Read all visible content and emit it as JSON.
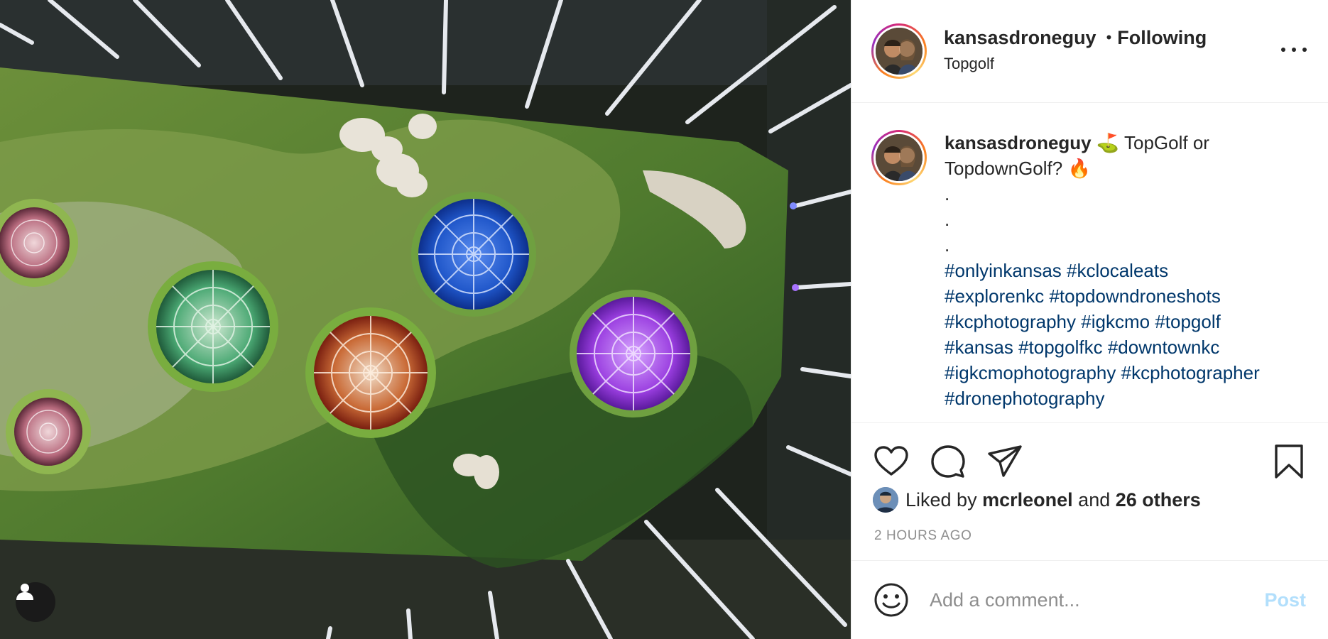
{
  "post": {
    "author": {
      "username": "kansasdroneguy",
      "follow_status": "Following",
      "location": "Topgolf"
    },
    "caption": {
      "username": "kansasdroneguy",
      "text": "⛳ TopGolf or TopdownGolf? 🔥",
      "dot_lines": [
        ".",
        ".",
        "."
      ],
      "hashtags": [
        "#onlyinkansas",
        "#kclocaleats",
        "#explorenkc",
        "#topdowndroneshots",
        "#kcphotography",
        "#igkcmo",
        "#topgolf",
        "#kansas",
        "#topgolfkc",
        "#downtownkc",
        "#igkcmophotography",
        "#kcphotographer",
        "#dronephotography"
      ]
    },
    "likes": {
      "prefix": "Liked by",
      "top_liker": "mcrleonel",
      "conjunction": "and",
      "others": "26 others"
    },
    "timestamp": "2 HOURS AGO",
    "comment": {
      "placeholder": "Add a comment...",
      "post_label": "Post"
    }
  },
  "icons": {
    "like": "heart-icon",
    "comment": "comment-icon",
    "share": "paper-plane-icon",
    "save": "bookmark-icon",
    "emoji": "smiley-icon",
    "more": "ellipsis-icon",
    "user_tags": "user-icon"
  },
  "colors": {
    "hashtag": "#00376b",
    "text": "#262626",
    "muted": "#8e8e8e",
    "post_disabled": "#b2dffc",
    "turf": "#4f7a2e",
    "turf_light": "#7fa04a"
  }
}
